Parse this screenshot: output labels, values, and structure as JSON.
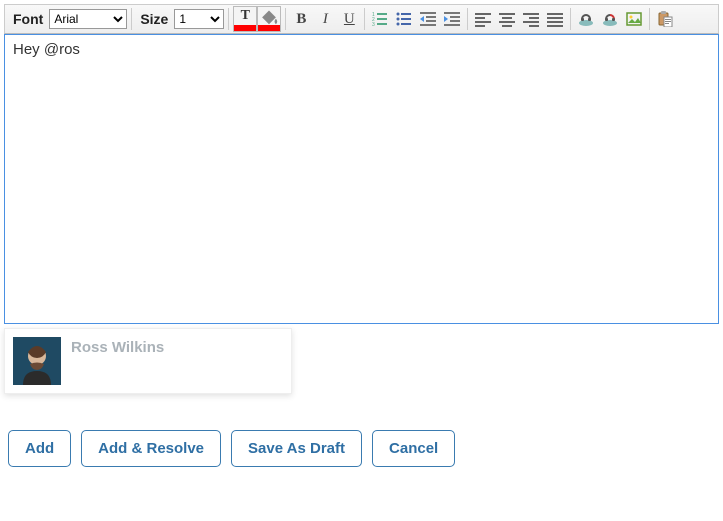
{
  "toolbar": {
    "font_label": "Font",
    "font_value": "Arial",
    "size_label": "Size",
    "size_value": "1"
  },
  "icons": {
    "text_color": "T",
    "bg_color": "fill",
    "bold": "B",
    "italic": "I",
    "underline": "U",
    "ordered_list": "ol",
    "unordered_list": "ul",
    "outdent": "outdent",
    "indent": "indent",
    "align_left": "left",
    "align_center": "center",
    "align_right": "right",
    "align_justify": "justify",
    "link": "link",
    "unlink": "unlink",
    "image": "image",
    "paste": "paste"
  },
  "editor": {
    "content": "Hey @ros"
  },
  "suggestion": {
    "name": "Ross Wilkins"
  },
  "buttons": {
    "add": "Add",
    "add_resolve": "Add & Resolve",
    "save_draft": "Save As Draft",
    "cancel": "Cancel"
  }
}
